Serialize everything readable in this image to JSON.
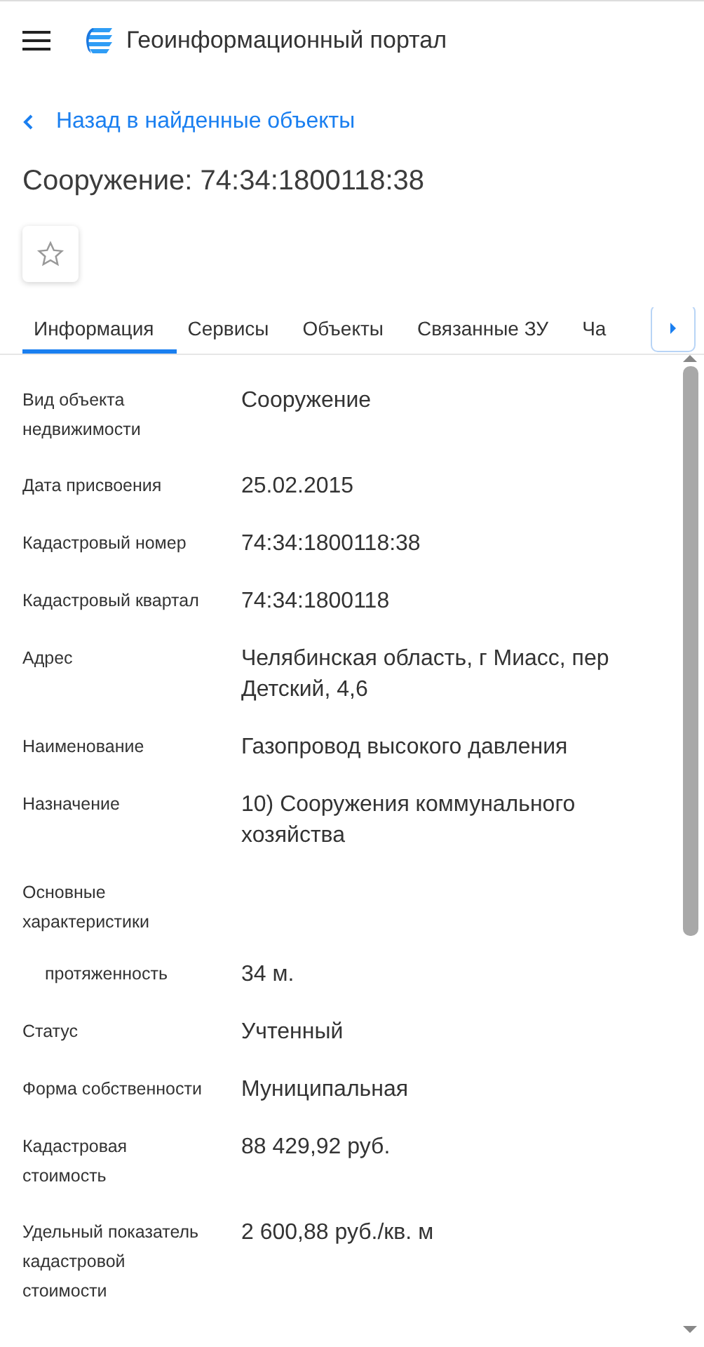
{
  "header": {
    "title": "Геоинформационный портал"
  },
  "back_link": {
    "label": "Назад в найденные объекты"
  },
  "page_title": "Сооружение: 74:34:1800118:38",
  "favorite": {
    "selected": false
  },
  "tabs": [
    {
      "label": "Информация",
      "selected": true
    },
    {
      "label": "Сервисы",
      "selected": false
    },
    {
      "label": "Объекты",
      "selected": false
    },
    {
      "label": "Связанные ЗУ",
      "selected": false
    },
    {
      "label": "Ча",
      "selected": false
    }
  ],
  "fields": [
    {
      "kind": "field",
      "label": "Вид объекта недвижимости",
      "value": "Сооружение"
    },
    {
      "kind": "field",
      "label": "Дата присвоения",
      "value": "25.02.2015"
    },
    {
      "kind": "field",
      "label": "Кадастровый номер",
      "value": "74:34:1800118:38"
    },
    {
      "kind": "field",
      "label": "Кадастровый квартал",
      "value": "74:34:1800118"
    },
    {
      "kind": "field",
      "label": "Адрес",
      "value": "Челябинская область, г Миасс, пер Детский, 4,6"
    },
    {
      "kind": "field",
      "label": "Наименование",
      "value": "Газопровод высокого давления"
    },
    {
      "kind": "field",
      "label": "Назначение",
      "value": "10) Сооружения коммунального хозяйства"
    },
    {
      "kind": "group",
      "label": "Основные характеристики"
    },
    {
      "kind": "sub",
      "label": "протяженность",
      "value": "34 м."
    },
    {
      "kind": "field",
      "label": "Статус",
      "value": "Учтенный"
    },
    {
      "kind": "field",
      "label": "Форма собственности",
      "value": "Муниципальная"
    },
    {
      "kind": "field",
      "label": "Кадастровая стоимость",
      "value": "88 429,92 руб."
    },
    {
      "kind": "field",
      "label": "Удельный показатель кадастровой стоимости",
      "value": "2 600,88 руб./кв. м"
    }
  ]
}
